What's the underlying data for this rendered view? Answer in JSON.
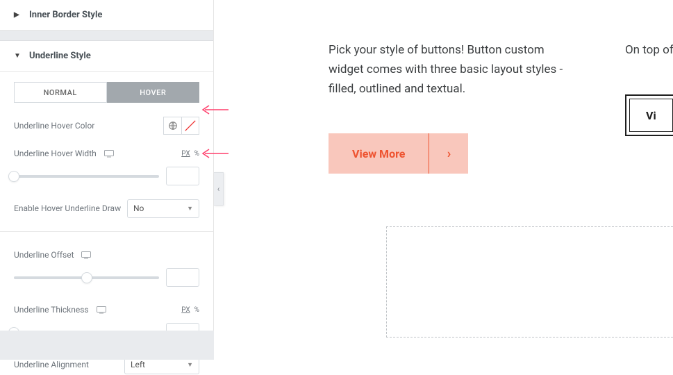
{
  "sidebar": {
    "sections": {
      "inner_border": {
        "title": "Inner Border Style"
      },
      "underline": {
        "title": "Underline Style"
      }
    },
    "tabs": {
      "normal": "NORMAL",
      "hover": "HOVER"
    },
    "controls": {
      "hover_color": {
        "label": "Underline Hover Color"
      },
      "hover_width": {
        "label": "Underline Hover Width",
        "unit_px": "PX",
        "unit_pct": "%",
        "value": ""
      },
      "enable_draw": {
        "label": "Enable Hover Underline Draw",
        "value": "No"
      },
      "offset": {
        "label": "Underline Offset",
        "value": ""
      },
      "thickness": {
        "label": "Underline Thickness",
        "unit_px": "PX",
        "unit_pct": "%",
        "value": ""
      },
      "alignment": {
        "label": "Underline Alignment",
        "value": "Left"
      }
    }
  },
  "preview": {
    "card1": {
      "text": "Pick your style of buttons! Button custom widget comes with three basic layout styles - filled, outlined and textual.",
      "button_label": "View More"
    },
    "card2": {
      "text": "On top of standard also get",
      "button_label": "Vi"
    }
  }
}
